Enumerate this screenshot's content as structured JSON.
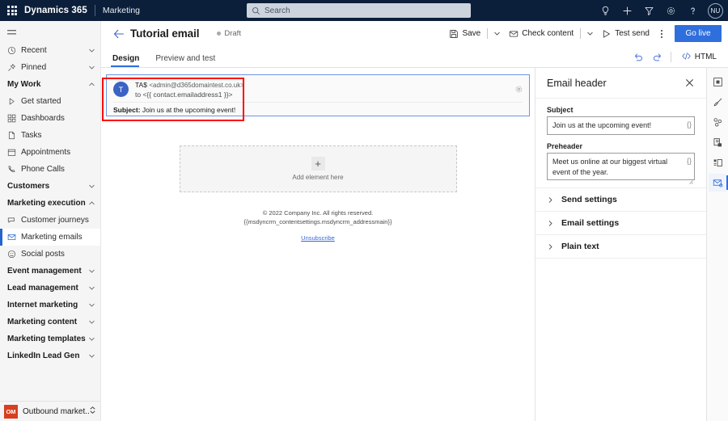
{
  "topbar": {
    "waffle_label": "app-launcher",
    "brand": "Dynamics 365",
    "app_name": "Marketing",
    "search_placeholder": "Search",
    "icons": [
      "lightbulb-icon",
      "plus-icon",
      "filter-icon",
      "gear-icon",
      "help-icon"
    ],
    "avatar_initials": "NU"
  },
  "sidebar": {
    "items": [
      {
        "label": "Recent",
        "icon": "clock-icon",
        "chevron": "down",
        "type": "item"
      },
      {
        "label": "Pinned",
        "icon": "pin-icon",
        "chevron": "down",
        "type": "item"
      },
      {
        "label": "My Work",
        "icon": "",
        "chevron": "up",
        "type": "group"
      },
      {
        "label": "Get started",
        "icon": "play-icon",
        "chevron": "",
        "type": "item"
      },
      {
        "label": "Dashboards",
        "icon": "dashboard-icon",
        "chevron": "",
        "type": "item"
      },
      {
        "label": "Tasks",
        "icon": "task-icon",
        "chevron": "",
        "type": "item"
      },
      {
        "label": "Appointments",
        "icon": "calendar-icon",
        "chevron": "",
        "type": "item"
      },
      {
        "label": "Phone Calls",
        "icon": "phone-icon",
        "chevron": "",
        "type": "item"
      },
      {
        "label": "Customers",
        "icon": "",
        "chevron": "down",
        "type": "group"
      },
      {
        "label": "Marketing execution",
        "icon": "",
        "chevron": "up",
        "type": "group"
      },
      {
        "label": "Customer journeys",
        "icon": "journey-icon",
        "chevron": "",
        "type": "item"
      },
      {
        "label": "Marketing emails",
        "icon": "envelope-icon",
        "chevron": "",
        "type": "item",
        "active": true
      },
      {
        "label": "Social posts",
        "icon": "social-icon",
        "chevron": "",
        "type": "item"
      },
      {
        "label": "Event management",
        "icon": "",
        "chevron": "down",
        "type": "group"
      },
      {
        "label": "Lead management",
        "icon": "",
        "chevron": "down",
        "type": "group"
      },
      {
        "label": "Internet marketing",
        "icon": "",
        "chevron": "down",
        "type": "group"
      },
      {
        "label": "Marketing content",
        "icon": "",
        "chevron": "down",
        "type": "group"
      },
      {
        "label": "Marketing templates",
        "icon": "",
        "chevron": "down",
        "type": "group"
      },
      {
        "label": "LinkedIn Lead Gen",
        "icon": "",
        "chevron": "down",
        "type": "group"
      }
    ],
    "area_switcher": {
      "badge": "OM",
      "label": "Outbound market..."
    }
  },
  "command_bar": {
    "back_label": "back-arrow",
    "title": "Tutorial email",
    "status": "Draft",
    "save_label": "Save",
    "check_content_label": "Check content",
    "test_send_label": "Test send",
    "overflow_label": "More commands",
    "go_live_label": "Go live"
  },
  "tabs": {
    "items": [
      {
        "label": "Design",
        "active": true
      },
      {
        "label": "Preview and test",
        "active": false
      }
    ],
    "undo_label": "Undo",
    "redo_label": "Redo",
    "html_label": "HTML"
  },
  "canvas": {
    "email_header": {
      "avatar_initial": "T",
      "from_name": "TA$",
      "from_address": "<admin@d365domaintest.co.uk>",
      "to_line": "to <{{ contact.emailaddress1 }}>",
      "subject_label": "Subject:",
      "subject_value": "Join us at the upcoming event!",
      "gear_label": "block-settings"
    },
    "add_zone": {
      "plus": "+",
      "label": "Add element here"
    },
    "footer": {
      "copyright": "© 2022 Company Inc. All rights reserved.",
      "address_token": "{{msdyncrm_contentsettings.msdyncrm_addressmain}}",
      "unsubscribe": "Unsubscribe"
    }
  },
  "properties": {
    "title": "Email header",
    "close_label": "Close panel",
    "subject": {
      "label": "Subject",
      "value": "Join us at the upcoming event!",
      "token_button": "{}"
    },
    "preheader": {
      "label": "Preheader",
      "value": "Meet us online at our biggest virtual event of the year.",
      "token_button": "{}"
    },
    "sections": [
      {
        "label": "Send settings",
        "expanded": false
      },
      {
        "label": "Email settings",
        "expanded": false
      },
      {
        "label": "Plain text",
        "expanded": false
      }
    ]
  },
  "rail": {
    "items": [
      {
        "icon": "element-icon",
        "active": false
      },
      {
        "icon": "brush-icon",
        "active": false
      },
      {
        "icon": "blocks-icon",
        "active": false
      },
      {
        "icon": "library-icon",
        "active": false
      },
      {
        "icon": "layout-icon",
        "active": false
      },
      {
        "icon": "email-header-icon",
        "active": true
      }
    ]
  },
  "colors": {
    "topbar_bg": "#0b1f3a",
    "accent": "#2f6fdd",
    "selection_highlight": "#ff0000",
    "block_border": "#6f94e6",
    "area_badge": "#d6401f"
  }
}
